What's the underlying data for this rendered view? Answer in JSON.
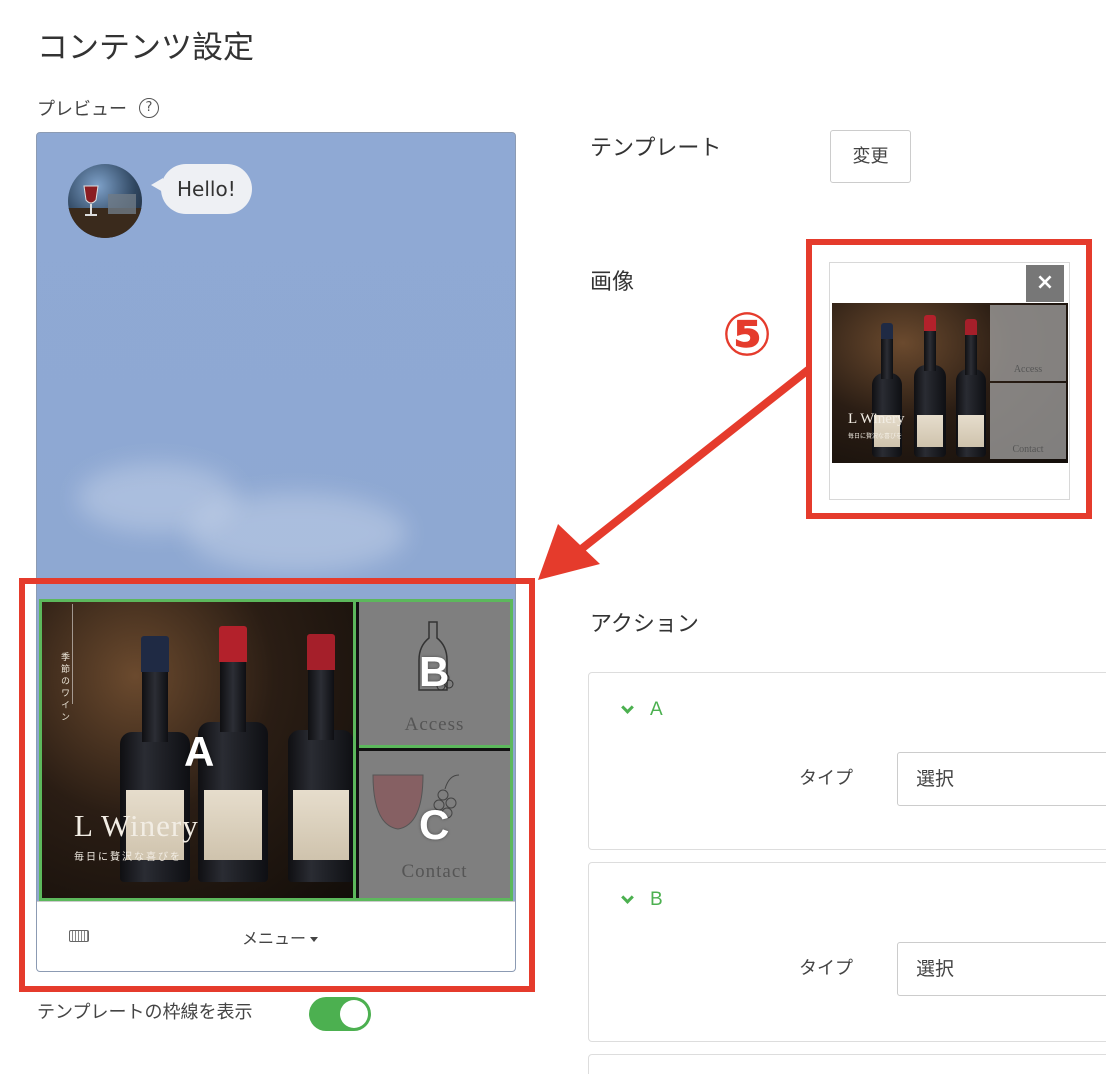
{
  "page": {
    "title": "コンテンツ設定"
  },
  "preview": {
    "label": "プレビュー",
    "help_icon": "?",
    "chat": {
      "message": "Hello!"
    },
    "rich_menu": {
      "cells": [
        {
          "letter": "A",
          "title": "L Winery",
          "subtitle": "毎日に贅沢な喜びを",
          "vertical_text": "季節のワイン"
        },
        {
          "letter": "B",
          "word": "Access"
        },
        {
          "letter": "C",
          "word": "Contact"
        }
      ]
    },
    "menu_bar": {
      "menu_label": "メニュー"
    },
    "border_toggle": {
      "label": "テンプレートの枠線を表示",
      "on": true
    }
  },
  "settings": {
    "template": {
      "label": "テンプレート",
      "change_button": "変更"
    },
    "image": {
      "label": "画像",
      "close": "×",
      "thumb_title": "L Winery",
      "thumb_subtitle": "毎日に贅沢な喜びを",
      "thumb_access": "Access",
      "thumb_contact": "Contact"
    },
    "actions": {
      "label": "アクション",
      "items": [
        {
          "name": "A",
          "type_label": "タイプ",
          "type_value": "選択"
        },
        {
          "name": "B",
          "type_label": "タイプ",
          "type_value": "選択"
        }
      ]
    }
  },
  "annotation": {
    "step": "⑤",
    "color": "#e53b2c"
  },
  "colors": {
    "accent": "#4cb050",
    "annotation": "#e53b2c",
    "chat_bg": "#8fa9d4"
  }
}
